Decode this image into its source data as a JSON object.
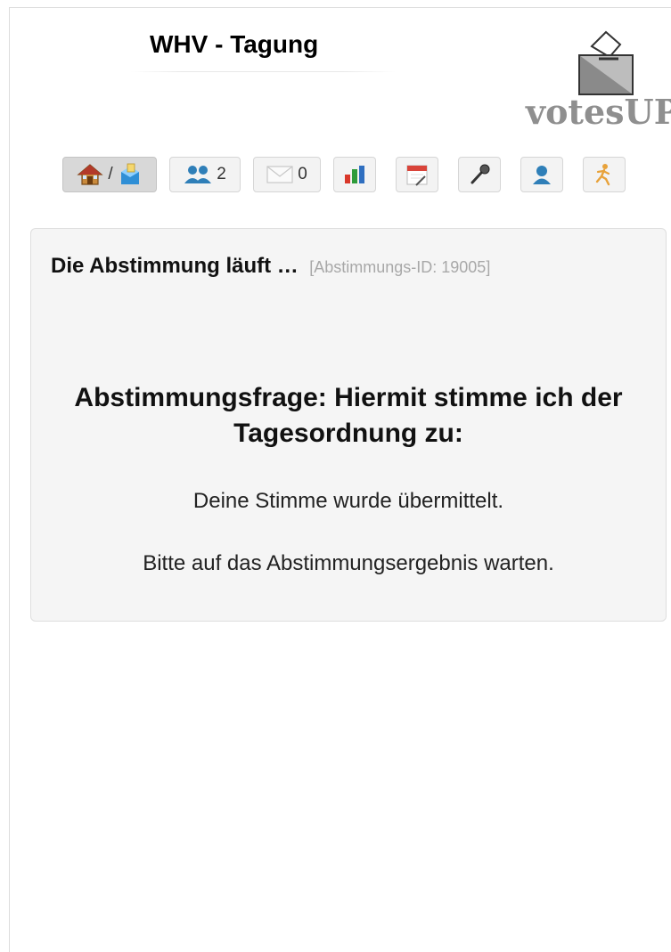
{
  "header": {
    "title": "WHV - Tagung",
    "logo_text": "votesUP!"
  },
  "toolbar": {
    "items": [
      {
        "name": "home-vote",
        "icons": [
          "house-icon",
          "ballot-box-icon"
        ],
        "separator": "/",
        "active": true
      },
      {
        "name": "participants",
        "icons": [
          "people-icon"
        ],
        "count": "2"
      },
      {
        "name": "messages",
        "icons": [
          "envelope-icon"
        ],
        "count": "0"
      },
      {
        "name": "results",
        "icons": [
          "bar-chart-icon"
        ]
      },
      {
        "name": "agenda",
        "icons": [
          "calendar-icon"
        ]
      },
      {
        "name": "speaker",
        "icons": [
          "microphone-icon"
        ]
      },
      {
        "name": "profile",
        "icons": [
          "user-icon"
        ]
      },
      {
        "name": "logout",
        "icons": [
          "running-man-icon"
        ]
      }
    ]
  },
  "panel": {
    "status": "Die Abstimmung läuft …",
    "vote_id": "[Abstimmungs-ID: 19005]",
    "question": "Abstimmungsfrage: Hiermit stimme ich der Tagesordnung zu:",
    "message_submitted": "Deine Stimme wurde übermittelt.",
    "message_wait": "Bitte auf das Abstimmungsergebnis warten."
  },
  "colors": {
    "panel_bg": "#f5f5f5",
    "logo": "#8f8f8f",
    "people_icon": "#2f7fb8",
    "chart_green": "#2e9b3a",
    "chart_red": "#d9382a"
  }
}
